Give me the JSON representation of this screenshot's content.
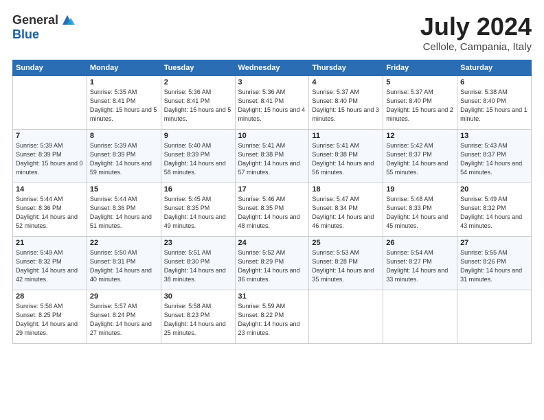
{
  "logo": {
    "general": "General",
    "blue": "Blue"
  },
  "title": "July 2024",
  "subtitle": "Cellole, Campania, Italy",
  "columns": [
    "Sunday",
    "Monday",
    "Tuesday",
    "Wednesday",
    "Thursday",
    "Friday",
    "Saturday"
  ],
  "weeks": [
    [
      {
        "day": "",
        "sunrise": "",
        "sunset": "",
        "daylight": ""
      },
      {
        "day": "1",
        "sunrise": "Sunrise: 5:35 AM",
        "sunset": "Sunset: 8:41 PM",
        "daylight": "Daylight: 15 hours and 5 minutes."
      },
      {
        "day": "2",
        "sunrise": "Sunrise: 5:36 AM",
        "sunset": "Sunset: 8:41 PM",
        "daylight": "Daylight: 15 hours and 5 minutes."
      },
      {
        "day": "3",
        "sunrise": "Sunrise: 5:36 AM",
        "sunset": "Sunset: 8:41 PM",
        "daylight": "Daylight: 15 hours and 4 minutes."
      },
      {
        "day": "4",
        "sunrise": "Sunrise: 5:37 AM",
        "sunset": "Sunset: 8:40 PM",
        "daylight": "Daylight: 15 hours and 3 minutes."
      },
      {
        "day": "5",
        "sunrise": "Sunrise: 5:37 AM",
        "sunset": "Sunset: 8:40 PM",
        "daylight": "Daylight: 15 hours and 2 minutes."
      },
      {
        "day": "6",
        "sunrise": "Sunrise: 5:38 AM",
        "sunset": "Sunset: 8:40 PM",
        "daylight": "Daylight: 15 hours and 1 minute."
      }
    ],
    [
      {
        "day": "7",
        "sunrise": "Sunrise: 5:39 AM",
        "sunset": "Sunset: 8:39 PM",
        "daylight": "Daylight: 15 hours and 0 minutes."
      },
      {
        "day": "8",
        "sunrise": "Sunrise: 5:39 AM",
        "sunset": "Sunset: 8:39 PM",
        "daylight": "Daylight: 14 hours and 59 minutes."
      },
      {
        "day": "9",
        "sunrise": "Sunrise: 5:40 AM",
        "sunset": "Sunset: 8:39 PM",
        "daylight": "Daylight: 14 hours and 58 minutes."
      },
      {
        "day": "10",
        "sunrise": "Sunrise: 5:41 AM",
        "sunset": "Sunset: 8:38 PM",
        "daylight": "Daylight: 14 hours and 57 minutes."
      },
      {
        "day": "11",
        "sunrise": "Sunrise: 5:41 AM",
        "sunset": "Sunset: 8:38 PM",
        "daylight": "Daylight: 14 hours and 56 minutes."
      },
      {
        "day": "12",
        "sunrise": "Sunrise: 5:42 AM",
        "sunset": "Sunset: 8:37 PM",
        "daylight": "Daylight: 14 hours and 55 minutes."
      },
      {
        "day": "13",
        "sunrise": "Sunrise: 5:43 AM",
        "sunset": "Sunset: 8:37 PM",
        "daylight": "Daylight: 14 hours and 54 minutes."
      }
    ],
    [
      {
        "day": "14",
        "sunrise": "Sunrise: 5:44 AM",
        "sunset": "Sunset: 8:36 PM",
        "daylight": "Daylight: 14 hours and 52 minutes."
      },
      {
        "day": "15",
        "sunrise": "Sunrise: 5:44 AM",
        "sunset": "Sunset: 8:36 PM",
        "daylight": "Daylight: 14 hours and 51 minutes."
      },
      {
        "day": "16",
        "sunrise": "Sunrise: 5:45 AM",
        "sunset": "Sunset: 8:35 PM",
        "daylight": "Daylight: 14 hours and 49 minutes."
      },
      {
        "day": "17",
        "sunrise": "Sunrise: 5:46 AM",
        "sunset": "Sunset: 8:35 PM",
        "daylight": "Daylight: 14 hours and 48 minutes."
      },
      {
        "day": "18",
        "sunrise": "Sunrise: 5:47 AM",
        "sunset": "Sunset: 8:34 PM",
        "daylight": "Daylight: 14 hours and 46 minutes."
      },
      {
        "day": "19",
        "sunrise": "Sunrise: 5:48 AM",
        "sunset": "Sunset: 8:33 PM",
        "daylight": "Daylight: 14 hours and 45 minutes."
      },
      {
        "day": "20",
        "sunrise": "Sunrise: 5:49 AM",
        "sunset": "Sunset: 8:32 PM",
        "daylight": "Daylight: 14 hours and 43 minutes."
      }
    ],
    [
      {
        "day": "21",
        "sunrise": "Sunrise: 5:49 AM",
        "sunset": "Sunset: 8:32 PM",
        "daylight": "Daylight: 14 hours and 42 minutes."
      },
      {
        "day": "22",
        "sunrise": "Sunrise: 5:50 AM",
        "sunset": "Sunset: 8:31 PM",
        "daylight": "Daylight: 14 hours and 40 minutes."
      },
      {
        "day": "23",
        "sunrise": "Sunrise: 5:51 AM",
        "sunset": "Sunset: 8:30 PM",
        "daylight": "Daylight: 14 hours and 38 minutes."
      },
      {
        "day": "24",
        "sunrise": "Sunrise: 5:52 AM",
        "sunset": "Sunset: 8:29 PM",
        "daylight": "Daylight: 14 hours and 36 minutes."
      },
      {
        "day": "25",
        "sunrise": "Sunrise: 5:53 AM",
        "sunset": "Sunset: 8:28 PM",
        "daylight": "Daylight: 14 hours and 35 minutes."
      },
      {
        "day": "26",
        "sunrise": "Sunrise: 5:54 AM",
        "sunset": "Sunset: 8:27 PM",
        "daylight": "Daylight: 14 hours and 33 minutes."
      },
      {
        "day": "27",
        "sunrise": "Sunrise: 5:55 AM",
        "sunset": "Sunset: 8:26 PM",
        "daylight": "Daylight: 14 hours and 31 minutes."
      }
    ],
    [
      {
        "day": "28",
        "sunrise": "Sunrise: 5:56 AM",
        "sunset": "Sunset: 8:25 PM",
        "daylight": "Daylight: 14 hours and 29 minutes."
      },
      {
        "day": "29",
        "sunrise": "Sunrise: 5:57 AM",
        "sunset": "Sunset: 8:24 PM",
        "daylight": "Daylight: 14 hours and 27 minutes."
      },
      {
        "day": "30",
        "sunrise": "Sunrise: 5:58 AM",
        "sunset": "Sunset: 8:23 PM",
        "daylight": "Daylight: 14 hours and 25 minutes."
      },
      {
        "day": "31",
        "sunrise": "Sunrise: 5:59 AM",
        "sunset": "Sunset: 8:22 PM",
        "daylight": "Daylight: 14 hours and 23 minutes."
      },
      {
        "day": "",
        "sunrise": "",
        "sunset": "",
        "daylight": ""
      },
      {
        "day": "",
        "sunrise": "",
        "sunset": "",
        "daylight": ""
      },
      {
        "day": "",
        "sunrise": "",
        "sunset": "",
        "daylight": ""
      }
    ]
  ]
}
